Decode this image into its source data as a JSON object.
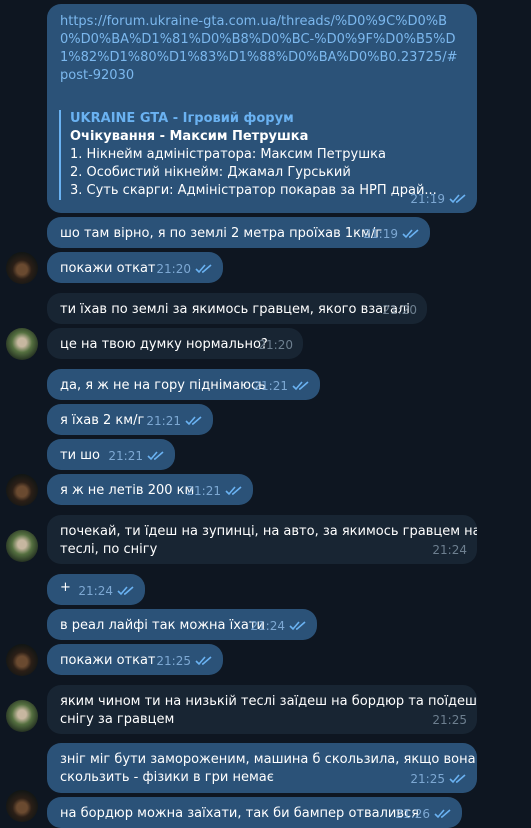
{
  "link_message": {
    "url": "https://forum.ukraine-gta.com.ua/threads/%D0%9C%D0%B0%D0%BA%D1%81%D0%B8%D0%BC-%D0%9F%D0%B5%D1%82%D1%80%D1%83%D1%88%D0%BA%D0%B0.23725/#post-92030",
    "preview_site": "UKRAINE GTA - Ігровий форум",
    "preview_title": "Очікування - Максим Петрушка",
    "preview_lines": [
      "1. Нікнейм адміністратора: Максим Петрушка",
      "2. Особистий нікнейм: Джамал Гурський",
      "3. Суть скарги: Адміністратор покарав за НРП драй..."
    ],
    "time": "21:19"
  },
  "messages": [
    {
      "text": "шо там вірно, я по землі 2 метра проїхав 1км/г",
      "time": "21:19"
    },
    {
      "text": "покажи откат",
      "time": "21:20"
    },
    {
      "text": "ти їхав по землі за якимось гравцем, якого взагалі",
      "time": "21:20"
    },
    {
      "text": "це на твою думку нормально?",
      "time": "21:20"
    },
    {
      "text": "да, я ж не на гору піднімаюсь",
      "time": "21:21"
    },
    {
      "text": "я їхав 2 км/г",
      "time": "21:21"
    },
    {
      "text": "ти шо",
      "time": "21:21"
    },
    {
      "text": "я ж не летів 200 км",
      "time": "21:21"
    },
    {
      "text": "почекай, ти їдеш на зупинці, на авто, за якимось гравцем на",
      "text2": "теслі, по снігу",
      "time": "21:24"
    },
    {
      "text": "+",
      "time": "21:24"
    },
    {
      "text": "в реал лайфі так можна їхати",
      "time": "21:24"
    },
    {
      "text": "покажи откат",
      "time": "21:25"
    },
    {
      "text": "яким чином ти на низькій теслі заїдеш на бордюр та поїдеш по",
      "text2": "снігу за гравцем",
      "time": "21:25"
    },
    {
      "text": "зніг міг бути замороженим, машина б скользила, якщо вона не",
      "text2": "скользить - фізики в гри немає",
      "time": "21:25"
    },
    {
      "text": "на бордюр можна заїхати, так би бампер отвалився",
      "time": "21:26"
    }
  ]
}
